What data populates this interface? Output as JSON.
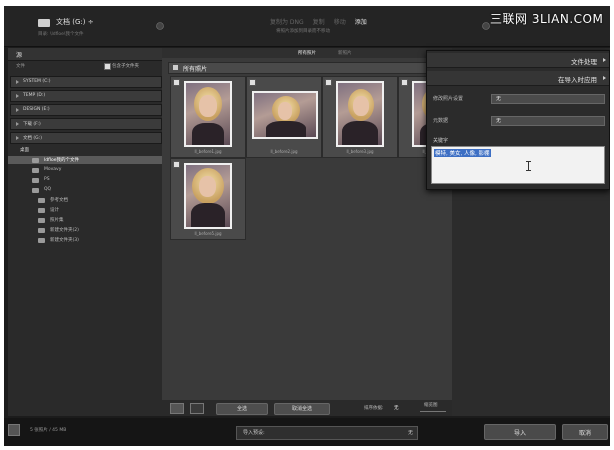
{
  "watermark": "三联网 3LIAN.COM",
  "header": {
    "source_title": "文档 (G:) ÷",
    "source_sub": "目录: \\ldfloe\\我个文件",
    "modes": [
      {
        "label": "复制为 DNG",
        "active": false
      },
      {
        "label": "复制",
        "active": false
      },
      {
        "label": "移动",
        "active": false
      },
      {
        "label": "添加",
        "active": true
      }
    ],
    "mode_sub": "将照片添加到目录而不移动"
  },
  "left_panel": {
    "title": "源",
    "option_label": "文件",
    "option_checkbox": "包含子文件夹",
    "volumes": [
      "SYSTEM (C:)",
      "TEMP (D:)",
      "DESIGN (E:)",
      "下载 (F:)",
      "文档 (G:)"
    ],
    "tree_root": "桌面",
    "folders": [
      {
        "label": "ldfloe我的个文件",
        "selected": true
      },
      {
        "label": "Movavy",
        "selected": false
      },
      {
        "label": "PS",
        "selected": false
      },
      {
        "label": "QQ",
        "selected": false
      },
      {
        "label": "参考文档",
        "selected": false
      },
      {
        "label": "设计",
        "selected": false
      },
      {
        "label": "照片集",
        "selected": false
      },
      {
        "label": "新建文件夹(2)",
        "selected": false
      },
      {
        "label": "新建文件夹(3)",
        "selected": false
      }
    ]
  },
  "grid": {
    "tabs": [
      {
        "label": "所有照片",
        "active": true
      },
      {
        "label": "新照片",
        "active": false
      }
    ],
    "header": "所有照片",
    "photos": [
      {
        "filename": "ll_before1.jpg"
      },
      {
        "filename": "ll_before2.jpg"
      },
      {
        "filename": "ll_before3.jpg"
      },
      {
        "filename": "ll_before4.jpg"
      },
      {
        "filename": "ll_before5.jpg"
      }
    ],
    "check_all": "全选",
    "uncheck_all": "取消全选",
    "sort_label": "排序依据:",
    "sort_value": "无",
    "thumb_label": "缩览图"
  },
  "right_panel": {
    "file_handling": "文件处理",
    "apply_during_import": "在导入时应用",
    "develop_label": "修改照片设置",
    "develop_value": "无",
    "metadata_label": "元数据",
    "metadata_value": "无",
    "keywords_label": "关键字",
    "keywords_value": "模特, 美女, 人像, 影棚"
  },
  "status": {
    "text": "5 张照片 / 45 MB",
    "preset_label": "导入预设:",
    "preset_value": "无",
    "import_button": "导入",
    "cancel_button": "取消"
  }
}
